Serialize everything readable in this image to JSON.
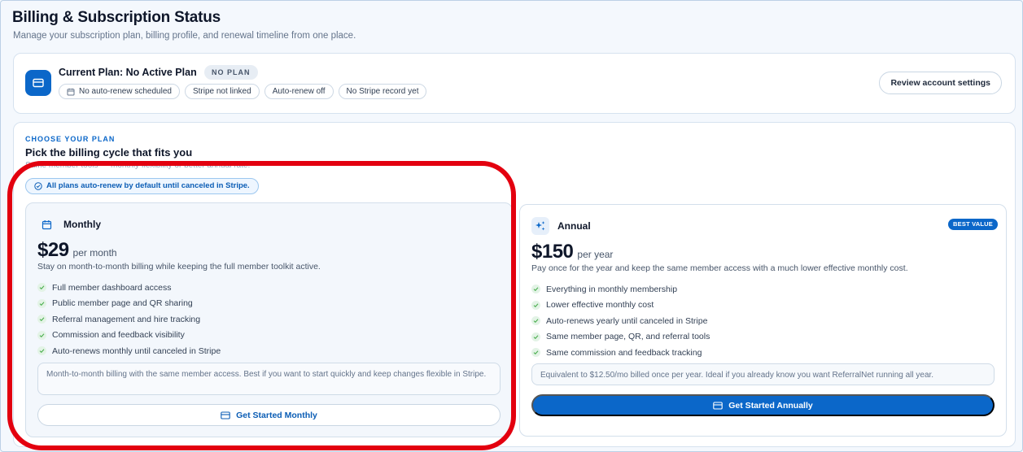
{
  "page": {
    "title": "Billing & Subscription Status",
    "subtitle": "Manage your subscription plan, billing profile, and renewal timeline from one place."
  },
  "current_plan": {
    "title": "Current Plan: No Active Plan",
    "badge": "NO PLAN",
    "chips": [
      {
        "label": "No auto-renew scheduled",
        "icon": "calendar-icon"
      },
      {
        "label": "Stripe not linked"
      },
      {
        "label": "Auto-renew off"
      },
      {
        "label": "No Stripe record yet"
      }
    ],
    "review_button": "Review account settings"
  },
  "plans_section": {
    "eyebrow": "CHOOSE YOUR PLAN",
    "title": "Pick the billing cycle that fits you",
    "subtitle": "Same member tools — monthly flexibility or better annual rate.",
    "auto_renew_note": "All plans auto-renew by default until canceled in Stripe."
  },
  "plans": {
    "monthly": {
      "name": "Monthly",
      "icon": "calendar-icon",
      "price": "$29",
      "period": "per month",
      "description": "Stay on month-to-month billing while keeping the full member toolkit active.",
      "features": [
        "Full member dashboard access",
        "Public member page and QR sharing",
        "Referral management and hire tracking",
        "Commission and feedback visibility",
        "Auto-renews monthly until canceled in Stripe"
      ],
      "note": "Month-to-month billing with the same member access. Best if you want to start quickly and keep changes flexible in Stripe.",
      "cta": "Get Started Monthly"
    },
    "annual": {
      "name": "Annual",
      "icon": "sparkle-icon",
      "badge": "BEST VALUE",
      "price": "$150",
      "period": "per year",
      "description": "Pay once for the year and keep the same member access with a much lower effective monthly cost.",
      "features": [
        "Everything in monthly membership",
        "Lower effective monthly cost",
        "Auto-renews yearly until canceled in Stripe",
        "Same member page, QR, and referral tools",
        "Same commission and feedback tracking"
      ],
      "note": "Equivalent to $12.50/mo billed once per year. Ideal if you already know you want ReferralNet running all year.",
      "cta": "Get Started Annually"
    }
  },
  "colors": {
    "accent": "#0b67c9",
    "highlight_ring": "#e3000f",
    "check": "#4caf50"
  }
}
